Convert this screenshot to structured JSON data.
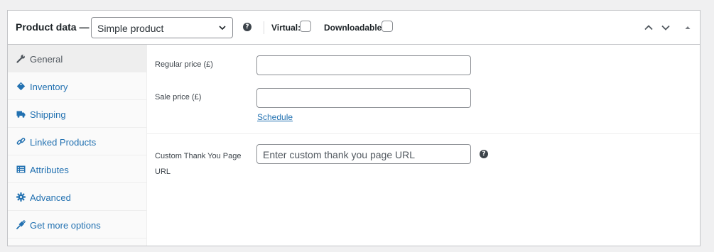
{
  "header": {
    "title": "Product data —",
    "product_type": "Simple product",
    "virtual_label": "Virtual:",
    "virtual_checked": false,
    "downloadable_label": "Downloadable:",
    "downloadable_checked": false,
    "help_glyph": "?"
  },
  "tabs": [
    {
      "label": "General",
      "icon": "wrench-icon",
      "active": true
    },
    {
      "label": "Inventory",
      "icon": "tag-icon",
      "active": false
    },
    {
      "label": "Shipping",
      "icon": "truck-icon",
      "active": false
    },
    {
      "label": "Linked Products",
      "icon": "link-icon",
      "active": false
    },
    {
      "label": "Attributes",
      "icon": "list-icon",
      "active": false
    },
    {
      "label": "Advanced",
      "icon": "gear-icon",
      "active": false
    },
    {
      "label": "Get more options",
      "icon": "plugin-icon",
      "active": false
    }
  ],
  "fields": {
    "regular_price": {
      "label": "Regular price (£)",
      "value": ""
    },
    "sale_price": {
      "label": "Sale price (£)",
      "value": ""
    },
    "schedule_link": "Schedule",
    "thank_you": {
      "label": "Custom Thank You Page URL",
      "placeholder": "Enter custom thank you page URL",
      "value": ""
    }
  },
  "colors": {
    "accent": "#2271b1",
    "border": "#c3c4c7",
    "background": "#f0f0f1"
  }
}
